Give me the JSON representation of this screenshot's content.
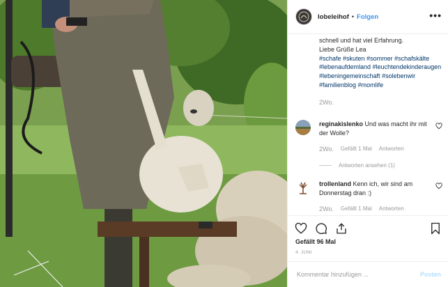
{
  "header": {
    "username": "lobeleihof",
    "follow_label": "Folgen",
    "more_label": "•••"
  },
  "caption": {
    "text_lines": [
      "schnell und hat viel Erfahrung.",
      "Liebe Grüße Lea"
    ],
    "hashtags": [
      "#schafe",
      "#skuten",
      "#sommer",
      "#schafskälte",
      "#lebenaufdemland",
      "#leuchtendekinderaugen",
      "#lebeningemeinschaft",
      "#solebenwir",
      "#familienblog",
      "#momlife"
    ],
    "time": "2Wo."
  },
  "comments": [
    {
      "user": "reginakislenko",
      "text": "Und was macht ihr mit der Wolle?",
      "time": "2Wo.",
      "likes": "Gefällt 1 Mal",
      "reply": "Antworten"
    },
    {
      "user": "trollenland",
      "text": "Kenn ich, wir sind am Donnerstag dran :)",
      "time": "2Wo.",
      "likes": "Gefällt 1 Mal",
      "reply": "Antworten"
    }
  ],
  "view_replies": "Antworten ansehen (1)",
  "likes_count": "Gefällt 96 Mal",
  "post_date": "4. JUNI",
  "comment_box": {
    "placeholder": "Kommentar hinzufügen ...",
    "post_label": "Posten"
  },
  "colors": {
    "link_blue": "#3897f0",
    "hashtag": "#003569",
    "muted": "#999999",
    "post_disabled": "#b2dffc"
  },
  "icons": [
    "heart-icon",
    "comment-icon",
    "share-icon",
    "bookmark-icon",
    "more-icon"
  ]
}
